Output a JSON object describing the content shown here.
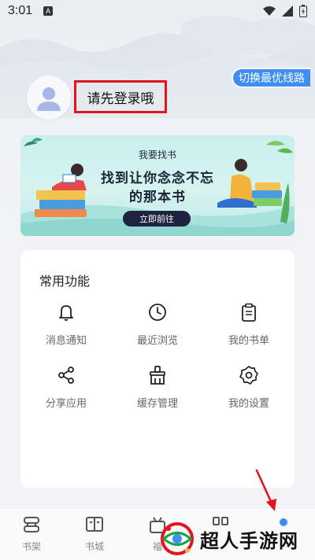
{
  "status_bar": {
    "time": "3:01",
    "badge": "A"
  },
  "profile": {
    "login_prompt": "请先登录哦",
    "switch_line_label": "切换最优线路"
  },
  "banner": {
    "subtitle": "我要找书",
    "title_line1": "找到让你念念不忘",
    "title_line2": "的那本书",
    "button_label": "立即前往"
  },
  "functions": {
    "title": "常用功能",
    "items": [
      {
        "label": "消息通知",
        "icon": "bell-icon"
      },
      {
        "label": "最近浏览",
        "icon": "clock-icon"
      },
      {
        "label": "我的书单",
        "icon": "clipboard-icon"
      },
      {
        "label": "分享应用",
        "icon": "share-icon"
      },
      {
        "label": "缓存管理",
        "icon": "broom-icon"
      },
      {
        "label": "我的设置",
        "icon": "gear-icon"
      }
    ]
  },
  "bottom_nav": {
    "items": [
      {
        "label": "书架",
        "icon": "bookshelf-icon"
      },
      {
        "label": "书城",
        "icon": "open-book-icon"
      },
      {
        "label": "福",
        "icon": "gift-icon"
      },
      {
        "label": "",
        "icon": "grid-icon"
      },
      {
        "label": "",
        "icon": "profile-icon"
      }
    ]
  },
  "watermark": {
    "text": "超人手游网"
  },
  "colors": {
    "accent_blue": "#3f8ef5",
    "highlight_red": "#e3141e",
    "banner_button": "#1d2340"
  }
}
